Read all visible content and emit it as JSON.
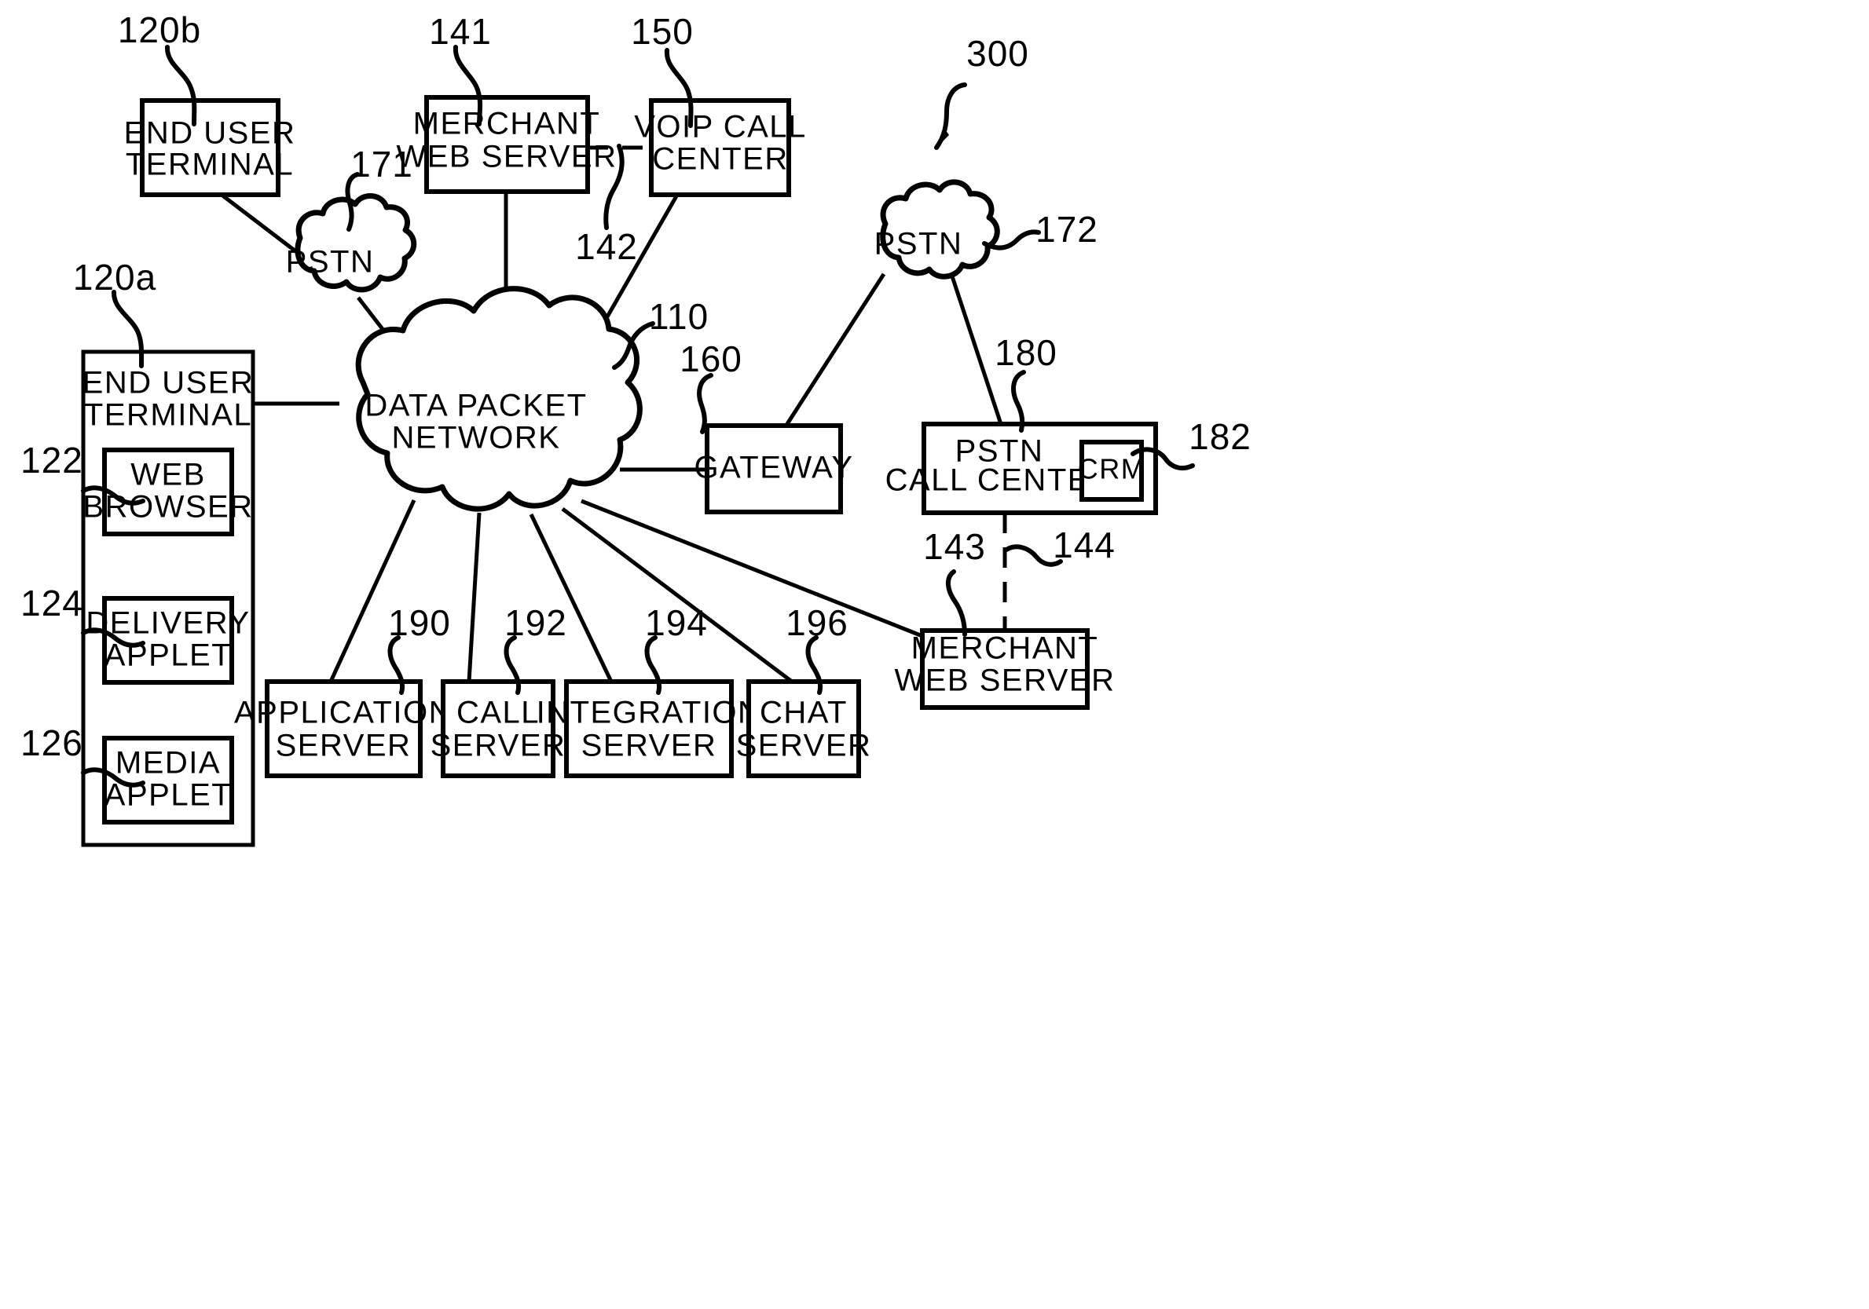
{
  "figure": {
    "figure_reference": "300",
    "nodes": [
      {
        "id": "end-user-terminal-b",
        "lines": [
          "END USER",
          "TERMINAL"
        ],
        "ref": "120b"
      },
      {
        "id": "merchant-web-server-top",
        "lines": [
          "MERCHANT",
          "WEB SERVER"
        ],
        "ref": "141"
      },
      {
        "id": "voip-call-center",
        "lines": [
          "VOIP CALL",
          "CENTER"
        ],
        "ref": "150"
      },
      {
        "id": "end-user-terminal-a",
        "lines": [
          "END USER",
          "TERMINAL"
        ],
        "ref": "120a"
      },
      {
        "id": "web-browser",
        "lines": [
          "WEB",
          "BROWSER"
        ],
        "ref": "122"
      },
      {
        "id": "delivery-applet",
        "lines": [
          "DELIVERY",
          "APPLET"
        ],
        "ref": "124"
      },
      {
        "id": "media-applet",
        "lines": [
          "MEDIA",
          "APPLET"
        ],
        "ref": "126"
      },
      {
        "id": "gateway",
        "lines": [
          "GATEWAY"
        ],
        "ref": "160"
      },
      {
        "id": "pstn-call-center",
        "lines": [
          "PSTN",
          "CALL CENTER"
        ],
        "ref": "180"
      },
      {
        "id": "crm",
        "lines": [
          "CRM"
        ],
        "ref": "182"
      },
      {
        "id": "merchant-web-server-bottom",
        "lines": [
          "MERCHANT",
          "WEB SERVER"
        ],
        "ref": "143"
      },
      {
        "id": "application-server",
        "lines": [
          "APPLICATION",
          "SERVER"
        ],
        "ref": "190"
      },
      {
        "id": "call-server",
        "lines": [
          "CALL",
          "SERVER"
        ],
        "ref": "192"
      },
      {
        "id": "integration-server",
        "lines": [
          "INTEGRATION",
          "SERVER"
        ],
        "ref": "194"
      },
      {
        "id": "chat-server",
        "lines": [
          "CHAT",
          "SERVER"
        ],
        "ref": "196"
      }
    ],
    "clouds": [
      {
        "id": "pstn-left",
        "label": "PSTN",
        "ref": "171"
      },
      {
        "id": "data-packet-network",
        "lines": [
          "DATA PACKET",
          "NETWORK"
        ],
        "ref": "110"
      },
      {
        "id": "pstn-right",
        "label": "PSTN",
        "ref": "172"
      }
    ],
    "connection_refs": [
      {
        "id": "link-142",
        "ref": "142",
        "style": "dashed"
      },
      {
        "id": "link-144",
        "ref": "144",
        "style": "dashed"
      }
    ],
    "labels": {
      "end_user_terminal_l1": "END USER",
      "end_user_terminal_l2": "TERMINAL",
      "merchant_l1": "MERCHANT",
      "merchant_l2": "WEB SERVER",
      "voip_l1": "VOIP CALL",
      "voip_l2": "CENTER",
      "web_browser_l1": "WEB",
      "web_browser_l2": "BROWSER",
      "delivery_applet_l1": "DELIVERY",
      "delivery_applet_l2": "APPLET",
      "media_applet_l1": "MEDIA",
      "media_applet_l2": "APPLET",
      "gateway": "GATEWAY",
      "pstn_call_center_l1": "PSTN",
      "pstn_call_center_l2": "CALL CENTER",
      "crm": "CRM",
      "application_server_l1": "APPLICATION",
      "application_server_l2": "SERVER",
      "call_server_l1": "CALL",
      "call_server_l2": "SERVER",
      "integration_server_l1": "INTEGRATION",
      "integration_server_l2": "SERVER",
      "chat_server_l1": "CHAT",
      "chat_server_l2": "SERVER",
      "pstn": "PSTN",
      "dpn_l1": "DATA PACKET",
      "dpn_l2": "NETWORK"
    },
    "refs": {
      "r120b": "120b",
      "r141": "141",
      "r150": "150",
      "r300": "300",
      "r171": "171",
      "r142": "142",
      "r172": "172",
      "r120a": "120a",
      "r110": "110",
      "r160": "160",
      "r180": "180",
      "r182": "182",
      "r122": "122",
      "r124": "124",
      "r126": "126",
      "r143": "143",
      "r144": "144",
      "r190": "190",
      "r192": "192",
      "r194": "194",
      "r196": "196"
    },
    "colors": {
      "ink": "#000000",
      "paper": "#ffffff"
    }
  }
}
